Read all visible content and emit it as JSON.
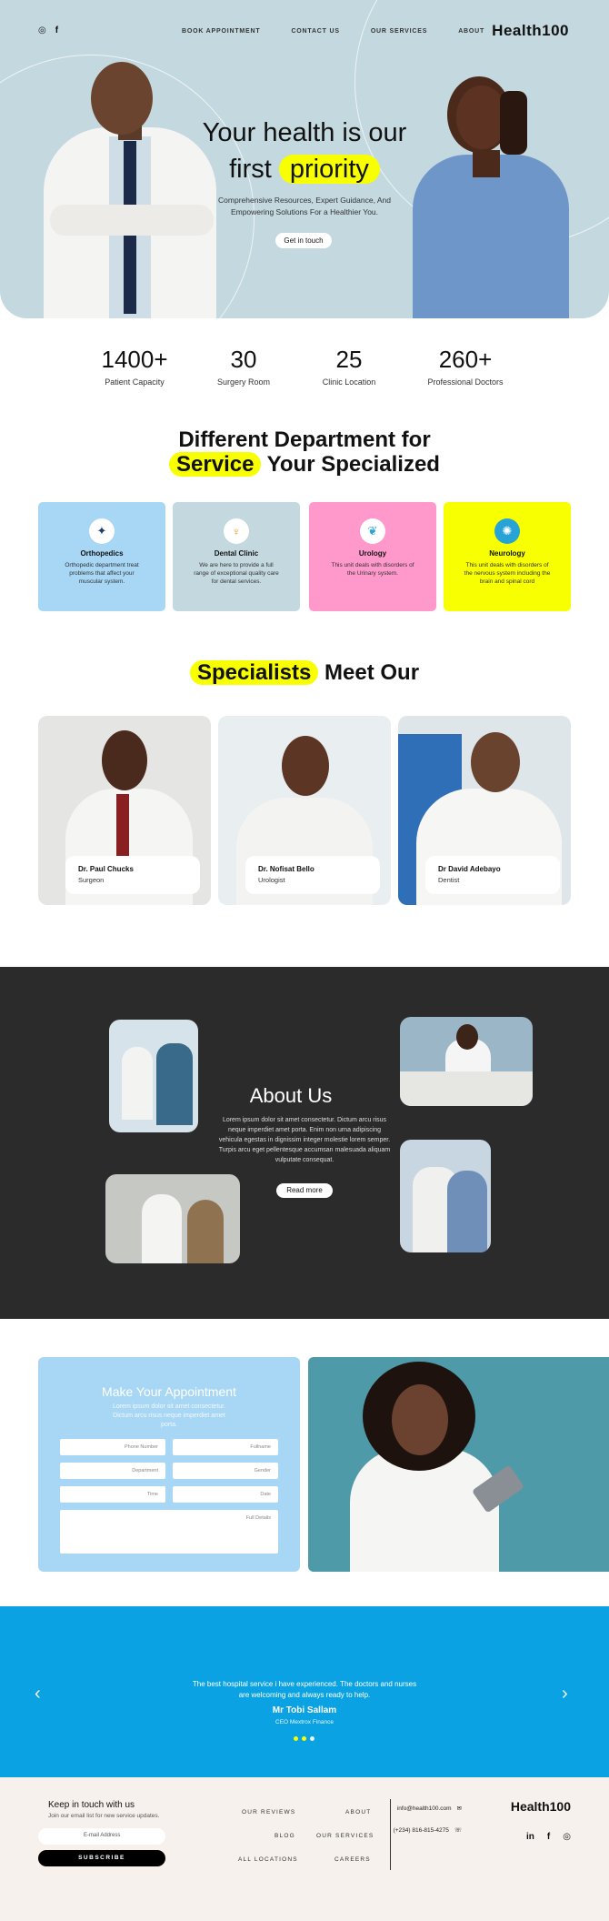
{
  "nav": {
    "brand": "Health100",
    "links": [
      "ABOUT",
      "OUR SERVICES",
      "CONTACT US",
      "BOOK APPOINTMENT"
    ],
    "social_icons": [
      "instagram-icon",
      "facebook-icon"
    ]
  },
  "hero": {
    "title_line1": "Your health is our",
    "title_word": "first",
    "title_highlight": "priority",
    "subtitle": "Comprehensive Resources, Expert Guidance, And Empowering Solutions For a Healthier You.",
    "cta": "Get in touch"
  },
  "stats": [
    {
      "value": "260+",
      "label": "Professional Doctors"
    },
    {
      "value": "25",
      "label": "Clinic Location"
    },
    {
      "value": "30",
      "label": "Surgery Room"
    },
    {
      "value": "1400+",
      "label": "Patient Capacity"
    }
  ],
  "departments": {
    "title_line1": "Different Department for",
    "title_line2_prefix": "Your Specialized",
    "title_highlight": "Service",
    "items": [
      {
        "name": "Neurology",
        "desc": "This unit deals with disorders of the nervous system including the brain and spinal cord",
        "color": "#f7ff00",
        "icon": "brain-icon"
      },
      {
        "name": "Urology",
        "desc": "This unit deals with disorders of the Urinary system.",
        "color": "#ff99cc",
        "icon": "kidney-icon"
      },
      {
        "name": "Dental Clinic",
        "desc": "We are here to provide a full range of exceptional quality care for dental services.",
        "color": "#c3d9df",
        "icon": "tooth-icon"
      },
      {
        "name": "Orthopedics",
        "desc": "Orthopedic department treat problems that affect your muscular system.",
        "color": "#a7d7f5",
        "icon": "bone-icon"
      }
    ]
  },
  "specialists": {
    "title_prefix": "Meet Our",
    "title_highlight": "Specialists",
    "items": [
      {
        "name": "Dr David Adebayo",
        "role": "Dentist"
      },
      {
        "name": "Dr. Nofisat Bello",
        "role": "Urologist"
      },
      {
        "name": "Dr. Paul Chucks",
        "role": "Surgeon"
      }
    ]
  },
  "about": {
    "title": "About Us",
    "text": "Lorem ipsum dolor sit amet consectetur. Dictum arcu risus neque imperdiet amet porta. Enim non urna adipiscing vehicula egestas in dignissim integer molestie lorem semper. Turpis arcu eget pellentesque accumsan malesuada aliquam vulputate consequat.",
    "cta": "Read more"
  },
  "appointment": {
    "title": "Make Your Appointment",
    "subtitle": "Lorem ipsum dolor sit amet consectetur. Dictum arcu risus neque imperdiet amet porta.",
    "fields": {
      "fullname": "Fullname",
      "phone": "Phone Number",
      "gender": "Gender",
      "department": "Department",
      "date": "Date",
      "time": "Time",
      "details": "Full Details"
    }
  },
  "testimonial": {
    "quote": "The best hospital service i have experienced. The doctors and nurses are welcoming and always ready to help.",
    "name": "Mr Tobi Sallam",
    "role": "CEO Mextrox Finance",
    "prev": "‹",
    "next": "›"
  },
  "footer": {
    "brand": "Health100",
    "email": "info@health100.com",
    "phone": "(+234) 816-815-4275",
    "social": [
      "in",
      "f",
      "◎"
    ],
    "links": [
      "ABOUT",
      "OUR REVIEWS",
      "OUR SERVICES",
      "BLOG",
      "CAREERS",
      "ALL LOCATIONS"
    ],
    "keep_title": "Keep in touch with us",
    "keep_sub": "Join our email list for new service updates.",
    "email_placeholder": "E-mail Address",
    "subscribe": "SUBSCRIBE"
  }
}
